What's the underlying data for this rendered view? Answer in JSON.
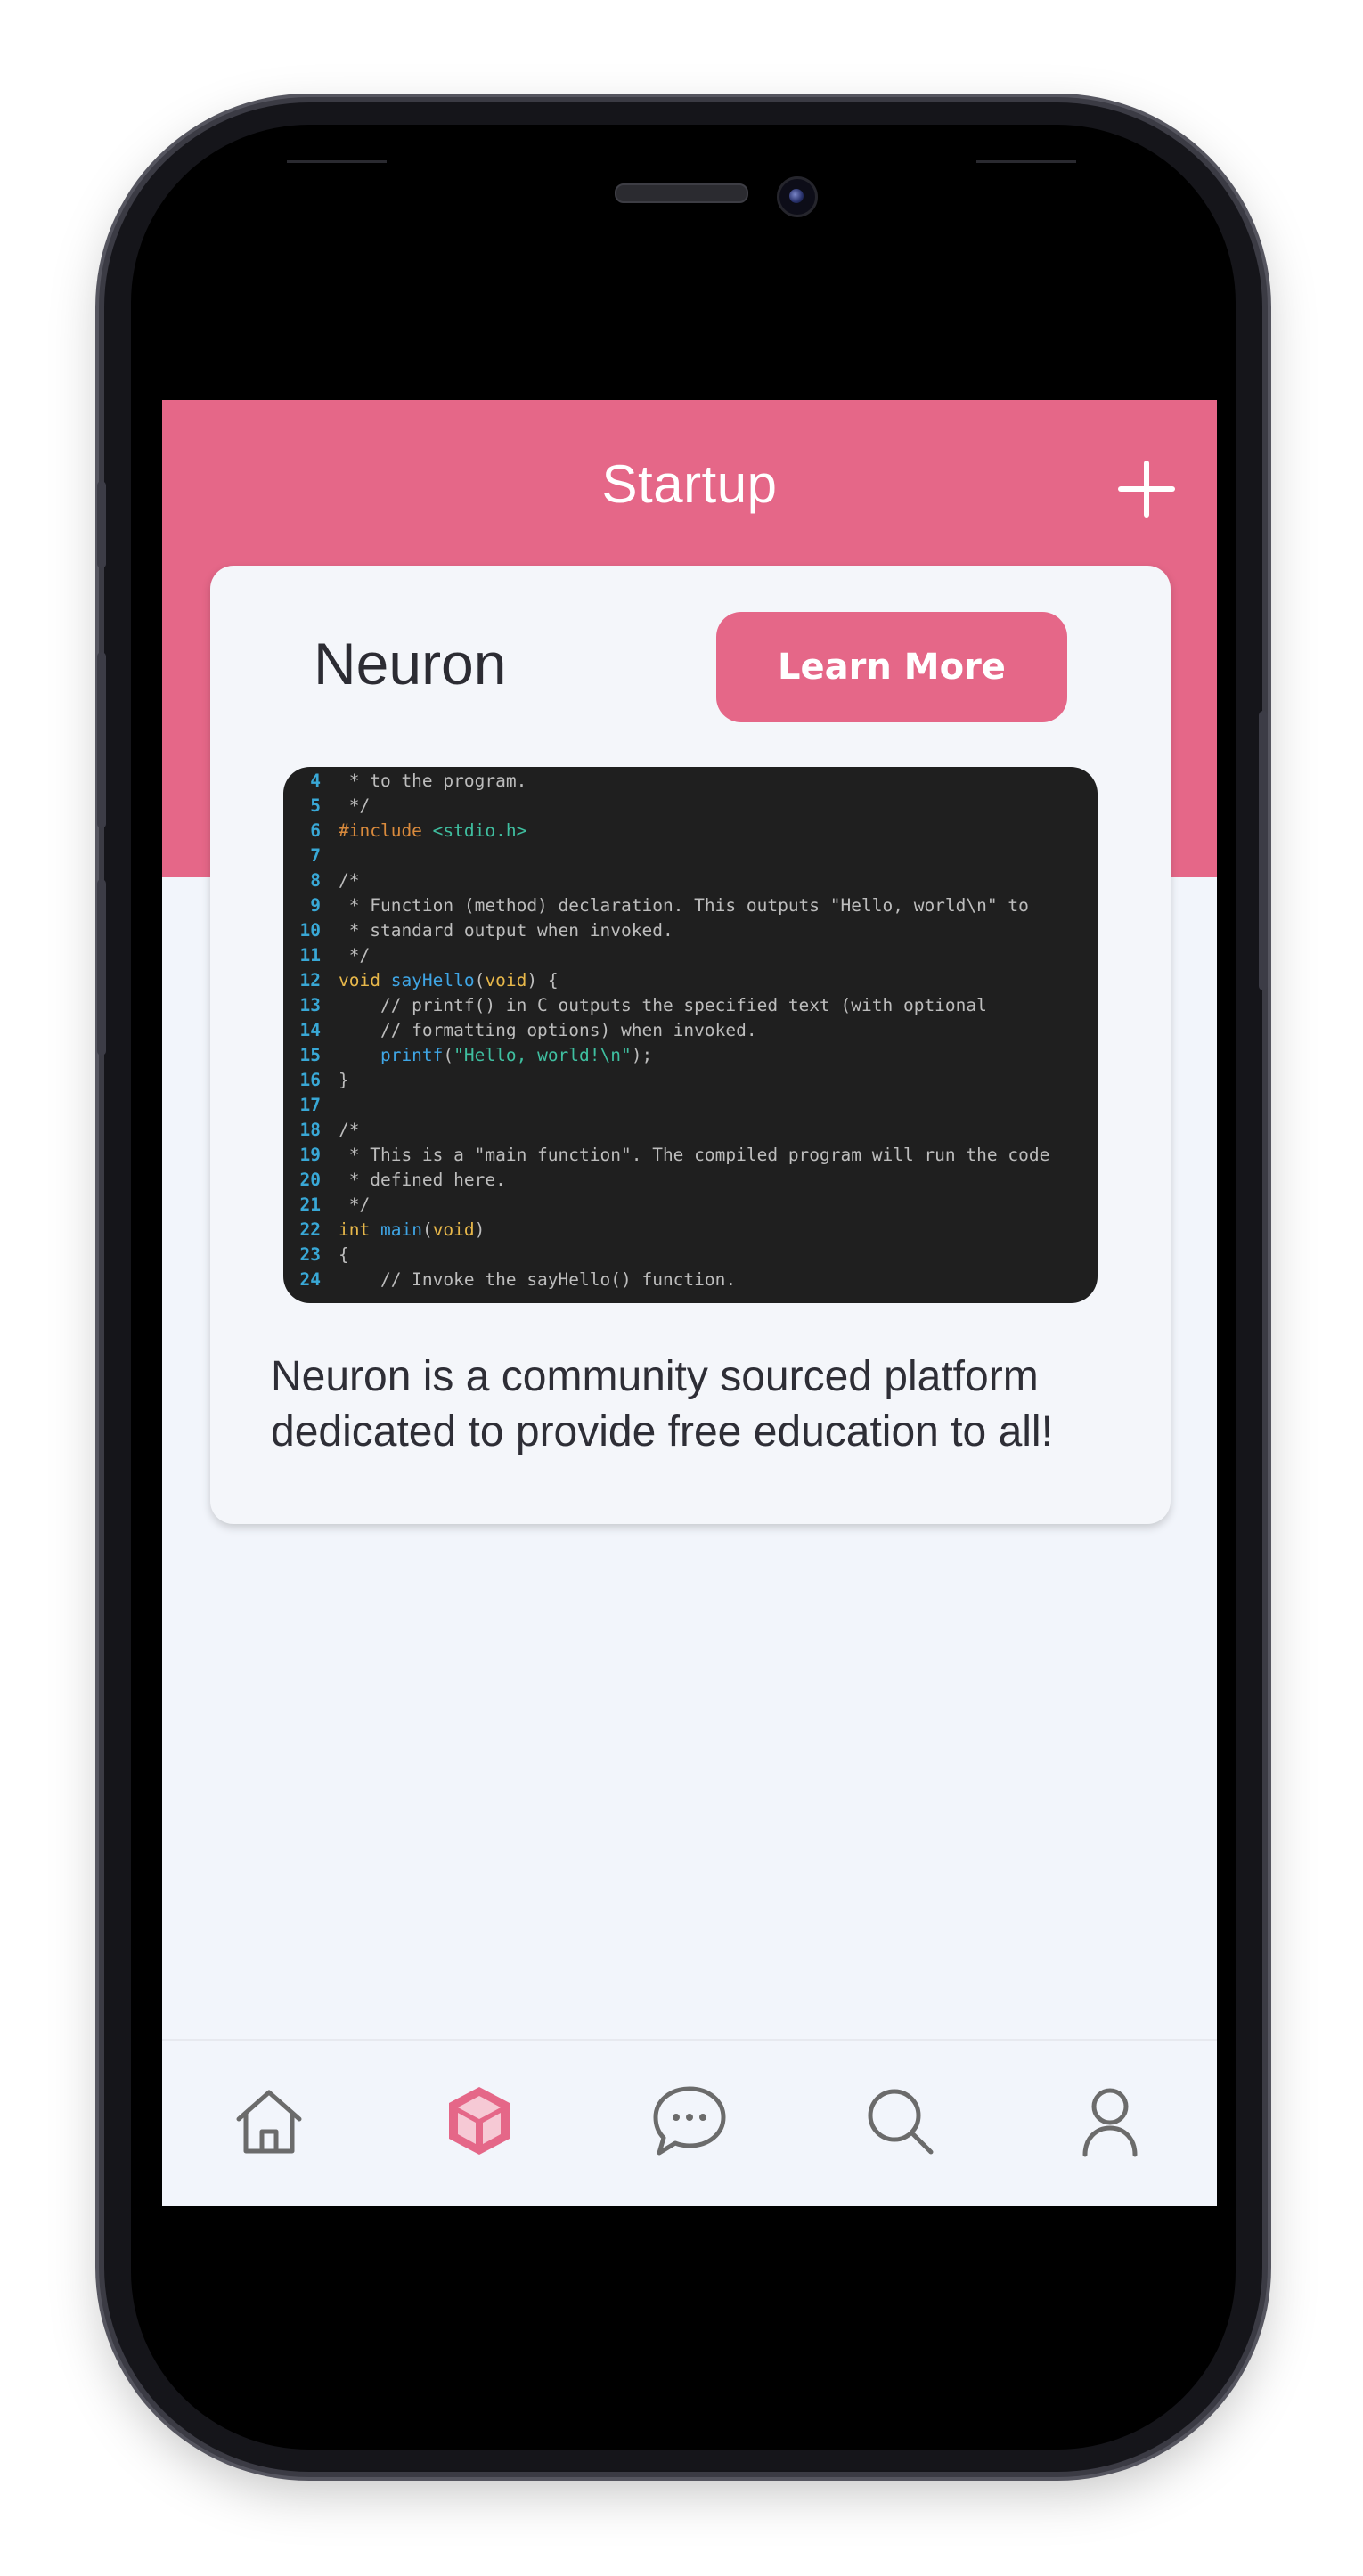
{
  "header": {
    "title": "Startup",
    "add_icon": "plus-icon"
  },
  "card": {
    "title": "Neuron",
    "button_label": "Learn More",
    "description_line1": "Neuron is a community sourced platform",
    "description_line2": "dedicated to provide free education to all!",
    "code_lines": [
      {
        "n": "4",
        "parts": [
          {
            "t": " * to the program.",
            "c": ""
          }
        ]
      },
      {
        "n": "5",
        "parts": [
          {
            "t": " */",
            "c": ""
          }
        ]
      },
      {
        "n": "6",
        "parts": [
          {
            "t": "#include ",
            "c": "c-pp"
          },
          {
            "t": "<stdio.h>",
            "c": "c-inc"
          }
        ]
      },
      {
        "n": "7",
        "parts": []
      },
      {
        "n": "8",
        "parts": [
          {
            "t": "/*",
            "c": ""
          }
        ]
      },
      {
        "n": "9",
        "parts": [
          {
            "t": " * Function (method) declaration. This outputs \"Hello, world\\n\" to",
            "c": ""
          }
        ]
      },
      {
        "n": "10",
        "parts": [
          {
            "t": " * standard output when invoked.",
            "c": ""
          }
        ]
      },
      {
        "n": "11",
        "parts": [
          {
            "t": " */",
            "c": ""
          }
        ]
      },
      {
        "n": "12",
        "parts": [
          {
            "t": "void ",
            "c": "c-kw"
          },
          {
            "t": "sayHello",
            "c": "c-fn"
          },
          {
            "t": "(",
            "c": ""
          },
          {
            "t": "void",
            "c": "c-kw"
          },
          {
            "t": ") {",
            "c": ""
          }
        ]
      },
      {
        "n": "13",
        "parts": [
          {
            "t": "    // printf() in C outputs the specified text (with optional",
            "c": ""
          }
        ]
      },
      {
        "n": "14",
        "parts": [
          {
            "t": "    // formatting options) when invoked.",
            "c": ""
          }
        ]
      },
      {
        "n": "15",
        "parts": [
          {
            "t": "    printf",
            "c": "c-fn"
          },
          {
            "t": "(",
            "c": ""
          },
          {
            "t": "\"Hello, world!\\n\"",
            "c": "c-str"
          },
          {
            "t": ");",
            "c": ""
          }
        ]
      },
      {
        "n": "16",
        "parts": [
          {
            "t": "}",
            "c": ""
          }
        ]
      },
      {
        "n": "17",
        "parts": []
      },
      {
        "n": "18",
        "parts": [
          {
            "t": "/*",
            "c": ""
          }
        ]
      },
      {
        "n": "19",
        "parts": [
          {
            "t": " * This is a \"main function\". The compiled program will run the code",
            "c": ""
          }
        ]
      },
      {
        "n": "20",
        "parts": [
          {
            "t": " * defined here.",
            "c": ""
          }
        ]
      },
      {
        "n": "21",
        "parts": [
          {
            "t": " */",
            "c": ""
          }
        ]
      },
      {
        "n": "22",
        "parts": [
          {
            "t": "int ",
            "c": "c-kw"
          },
          {
            "t": "main",
            "c": "c-fn"
          },
          {
            "t": "(",
            "c": ""
          },
          {
            "t": "void",
            "c": "c-kw"
          },
          {
            "t": ")",
            "c": ""
          }
        ]
      },
      {
        "n": "23",
        "parts": [
          {
            "t": "{",
            "c": ""
          }
        ]
      },
      {
        "n": "24",
        "parts": [
          {
            "t": "    // Invoke the sayHello() function.",
            "c": ""
          }
        ]
      }
    ]
  },
  "tabbar": {
    "items": [
      {
        "icon": "home-icon",
        "active": false
      },
      {
        "icon": "cube-icon",
        "active": true
      },
      {
        "icon": "chat-icon",
        "active": false
      },
      {
        "icon": "search-icon",
        "active": false
      },
      {
        "icon": "profile-icon",
        "active": false
      }
    ]
  },
  "colors": {
    "accent": "#e56788",
    "background": "#f2f5fb",
    "icon_inactive": "#6b6b6b",
    "code_bg": "#1f1f1f"
  }
}
